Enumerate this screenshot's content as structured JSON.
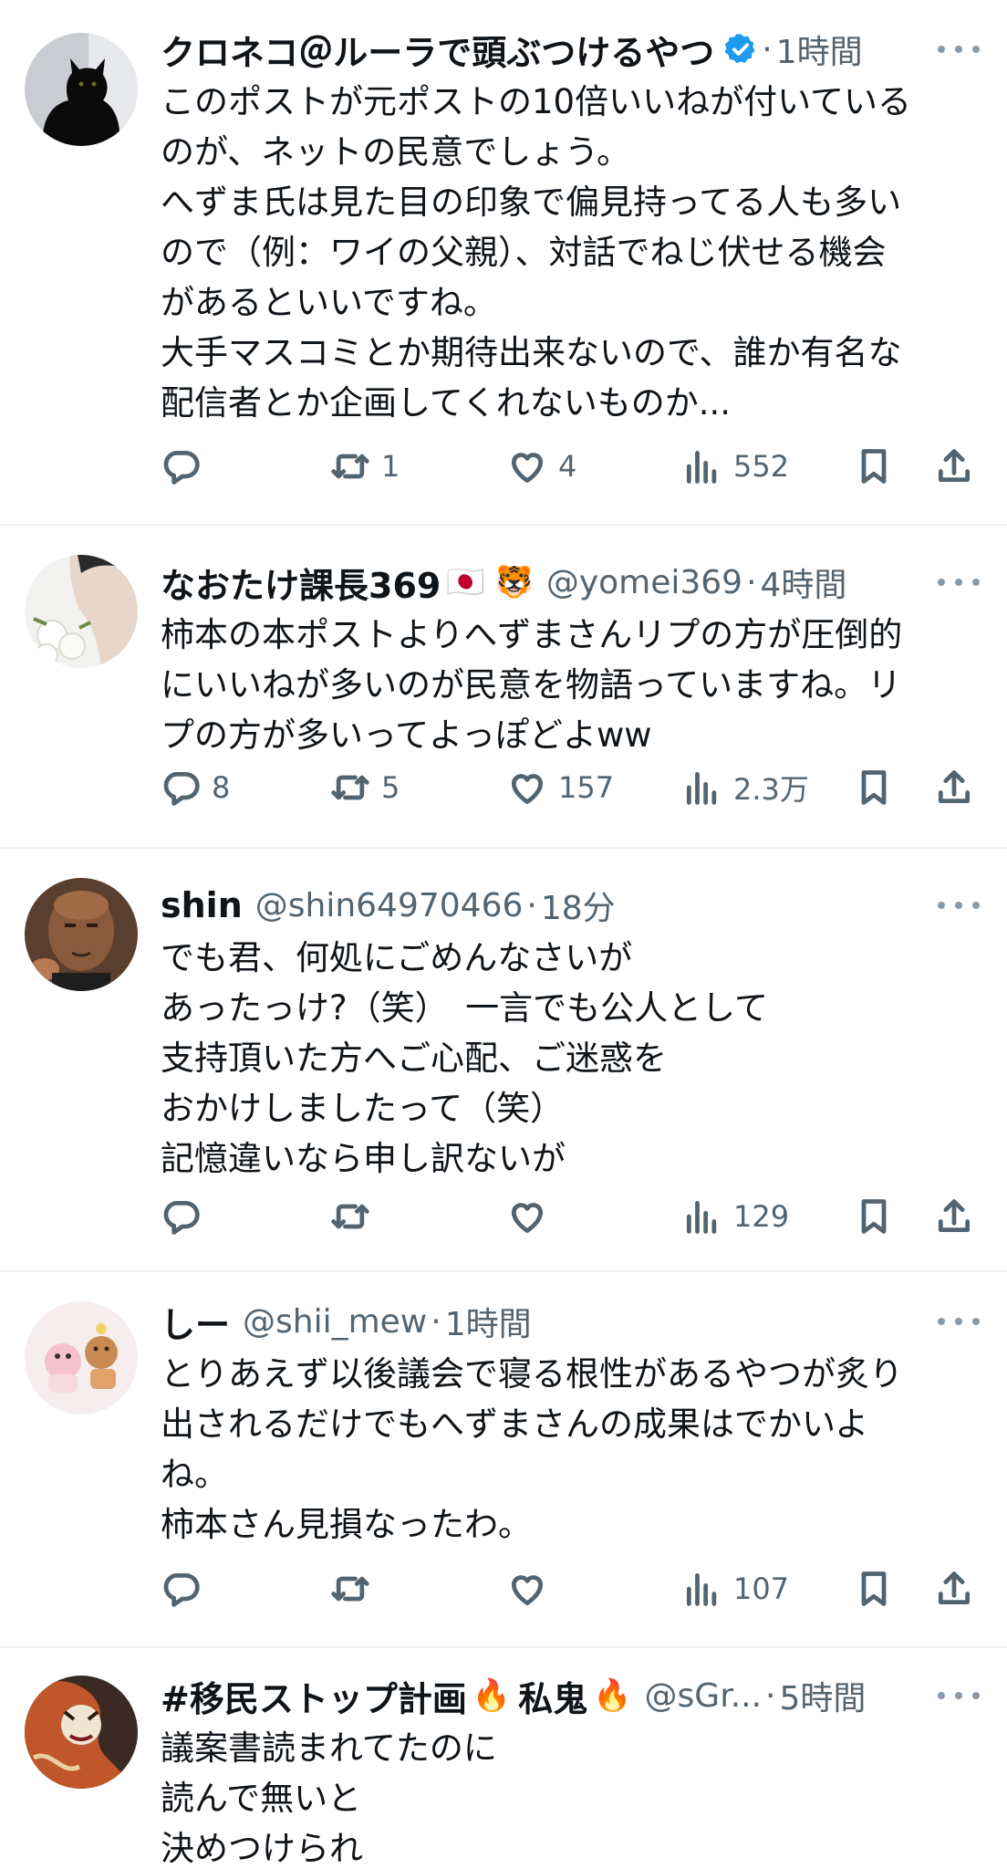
{
  "tweets": [
    {
      "display_name": "クロネコ＠ルーラで頭ぶつけるやつ",
      "handle": "",
      "time": "1時間",
      "verified": true,
      "emojis": "",
      "avatar": "black-cat",
      "lines": [
        "このポストが元ポストの10倍いいねが付いている",
        "のが、ネットの民意でしょう。",
        "へずま氏は見た目の印象で偏見持ってる人も多い",
        "ので（例：ワイの父親）、対話でねじ伏せる機会",
        "があるといいですね。",
        "大手マスコミとか期待出来ないので、誰か有名な",
        "配信者とか企画してくれないものか..."
      ],
      "replies": "",
      "retweets": "1",
      "likes": "4",
      "views": "552"
    },
    {
      "display_name": "なおたけ課長369",
      "handle": "@yomei369",
      "time": "4時間",
      "verified": false,
      "emojis": "🇯🇵 🐯",
      "avatar": "flowers-man",
      "lines": [
        "柿本の本ポストよりへずまさんリプの方が圧倒的",
        "にいいねが多いのが民意を物語っていますね。リ",
        "プの方が多いってよっぽどよww"
      ],
      "replies": "8",
      "retweets": "5",
      "likes": "157",
      "views": "2.3万"
    },
    {
      "display_name": "shin",
      "handle": "@shin64970466",
      "time": "18分",
      "verified": false,
      "emojis": "",
      "avatar": "bald-man",
      "lines": [
        "でも君、何処にごめんなさいが",
        "あったっけ?（笑）　一言でも公人として",
        "支持頂いた方へご心配、ご迷惑を",
        "おかけしましたって（笑）",
        "記憶違いなら申し訳ないが"
      ],
      "replies": "",
      "retweets": "",
      "likes": "",
      "views": "129"
    },
    {
      "display_name": "しー",
      "handle": "@shii_mew",
      "time": "1時間",
      "verified": false,
      "emojis": "",
      "avatar": "cute-bears",
      "lines": [
        "とりあえず以後議会で寝る根性があるやつが炙り",
        "出されるだけでもへずまさんの成果はでかいよ",
        "ね。",
        "柿本さん見損なったわ。"
      ],
      "replies": "",
      "retweets": "",
      "likes": "",
      "views": "107"
    },
    {
      "display_name": "#移民ストップ計画",
      "display_name_2": "私鬼",
      "handle": "@sGr...",
      "time": "5時間",
      "verified": false,
      "emojis": "🔥",
      "avatar": "demon-art",
      "lines": [
        "議案書読まれてたのに",
        "読んで無いと",
        "決めつけられ"
      ]
    }
  ],
  "colors": {
    "text": "#0f1419",
    "secondary": "#536471",
    "verified": "#1d9bf0",
    "divider": "#eff3f4"
  },
  "icons": [
    "reply-icon",
    "retweet-icon",
    "like-icon",
    "views-icon",
    "bookmark-icon",
    "share-icon",
    "verified-badge-icon",
    "more-icon"
  ]
}
